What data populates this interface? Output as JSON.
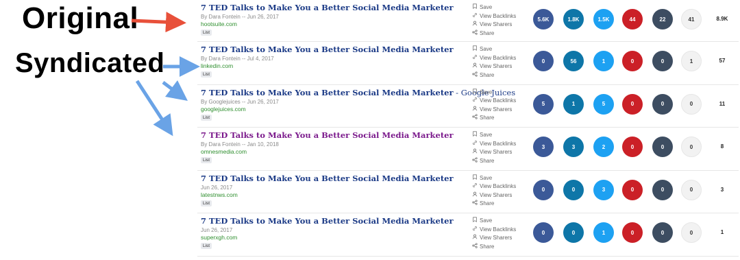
{
  "labels": {
    "original": "Original",
    "syndicated": "Syndicated"
  },
  "colors": {
    "facebook": "#3b5998",
    "linkedin": "#0e76a8",
    "twitter": "#1da1f2",
    "pinterest": "#cb2027",
    "reddit": "#3d4d61",
    "other": "#f2f2f2",
    "arrow_red": "#e8503a",
    "arrow_blue": "#6aa3e6"
  },
  "action_labels": {
    "save": "Save",
    "backlinks": "View Backlinks",
    "sharers": "View Sharers",
    "share": "Share"
  },
  "results": [
    {
      "title": "7 TED Talks to Make You a Better Social Media Marketer",
      "suffix": "",
      "meta": "By Dara Fontein -- Jun 26, 2017",
      "domain": "hootsuite.com",
      "tag": "List",
      "metrics": [
        "5.6K",
        "1.8K",
        "1.5K",
        "44",
        "22",
        "41"
      ],
      "total": "8.9K"
    },
    {
      "title": "7 TED Talks to Make You a Better Social Media Marketer",
      "suffix": "",
      "meta": "By Dara Fontein -- Jul 4, 2017",
      "domain": "linkedin.com",
      "tag": "List",
      "metrics": [
        "0",
        "56",
        "1",
        "0",
        "0",
        "1"
      ],
      "total": "57"
    },
    {
      "title": "7 TED Talks to Make You a Better Social Media Marketer",
      "suffix": " - Google Juices",
      "meta": "By Googlejuices -- Jun 26, 2017",
      "domain": "googlejuices.com",
      "tag": "List",
      "metrics": [
        "5",
        "1",
        "5",
        "0",
        "0",
        "0"
      ],
      "total": "11"
    },
    {
      "title": "7 TED Talks to Make You a Better Social Media Marketer",
      "suffix": "",
      "meta": "By Dara Fontein -- Jan 10, 2018",
      "domain": "omnesmedia.com",
      "tag": "List",
      "metrics": [
        "3",
        "3",
        "2",
        "0",
        "0",
        "0"
      ],
      "total": "8"
    },
    {
      "title": "7 TED Talks to Make You a Better Social Media Marketer",
      "suffix": "",
      "meta": "Jun 26, 2017",
      "domain": "latestnws.com",
      "tag": "List",
      "metrics": [
        "0",
        "0",
        "3",
        "0",
        "0",
        "0"
      ],
      "total": "3"
    },
    {
      "title": "7 TED Talks to Make You a Better Social Media Marketer",
      "suffix": "",
      "meta": "Jun 26, 2017",
      "domain": "superxgh.com",
      "tag": "List",
      "metrics": [
        "0",
        "0",
        "1",
        "0",
        "0",
        "0"
      ],
      "total": "1"
    }
  ]
}
